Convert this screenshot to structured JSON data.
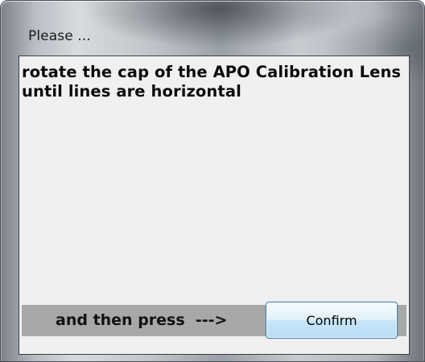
{
  "window": {
    "title": "Please ..."
  },
  "message": {
    "text": "rotate the cap of the APO Calibration Lens until lines are horizontal"
  },
  "bottom_bar": {
    "instruction": "and then press  --->",
    "confirm_label": "Confirm"
  },
  "colors": {
    "client_background": "#f0f0f0",
    "strip_background": "#a8a8a8",
    "button_border": "#3c7fb1"
  }
}
